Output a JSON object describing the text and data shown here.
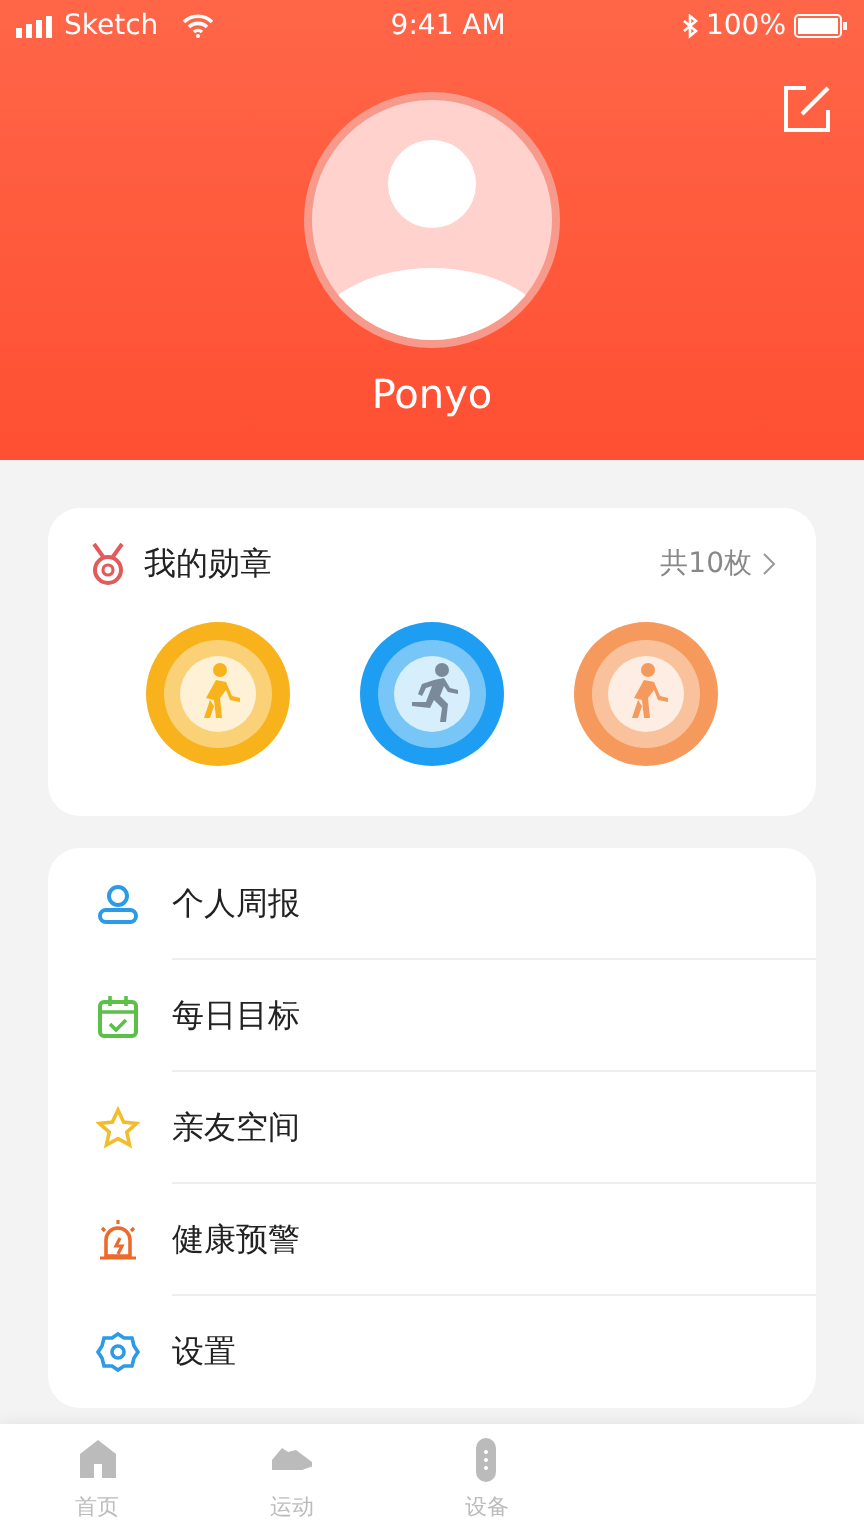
{
  "status_bar": {
    "carrier": "Sketch",
    "time": "9:41 AM",
    "battery": "100%"
  },
  "profile": {
    "name": "Ponyo"
  },
  "medals": {
    "title": "我的勋章",
    "count": "共10枚",
    "items": [
      {
        "color": "#f7b21c",
        "kind": "walking"
      },
      {
        "color": "#1e9ef2",
        "kind": "running"
      },
      {
        "color": "#f59a5c",
        "kind": "walking"
      }
    ]
  },
  "menu": [
    {
      "label": "个人周报",
      "kind": "person"
    },
    {
      "label": "每日目标",
      "kind": "calendar"
    },
    {
      "label": "亲友空间",
      "kind": "star"
    },
    {
      "label": "健康预警",
      "kind": "alarm"
    },
    {
      "label": "设置",
      "kind": "gear"
    }
  ],
  "tab_bar": [
    {
      "label": "首页",
      "kind": "home",
      "selected": false
    },
    {
      "label": "运动",
      "kind": "shoe",
      "selected": false
    },
    {
      "label": "设备",
      "kind": "band",
      "selected": false
    }
  ]
}
